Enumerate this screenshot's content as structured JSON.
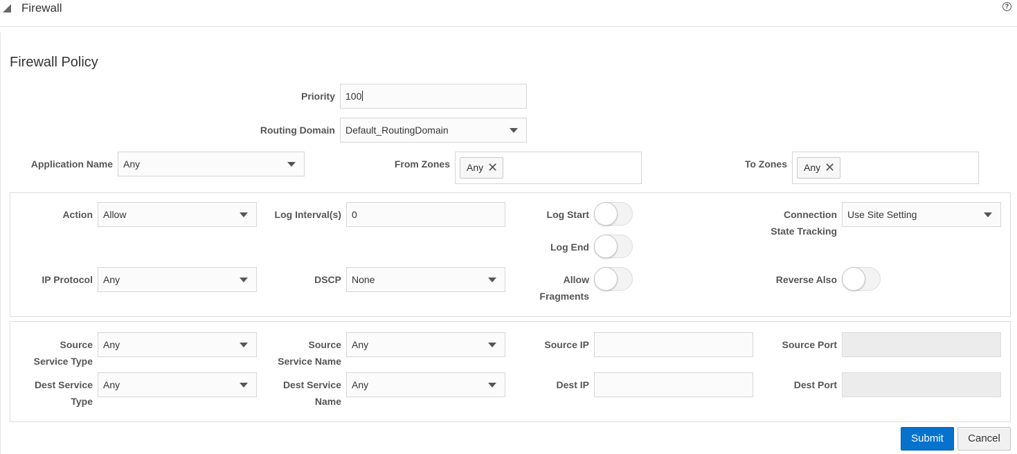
{
  "header": {
    "title": "Firewall",
    "help_glyph": "?"
  },
  "policy": {
    "title": "Firewall Policy",
    "priority": {
      "label": "Priority",
      "value": "100"
    },
    "routing_domain": {
      "label": "Routing Domain",
      "value": "Default_RoutingDomain"
    },
    "application_name": {
      "label": "Application Name",
      "value": "Any"
    },
    "from_zones": {
      "label": "From Zones",
      "tag": "Any"
    },
    "to_zones": {
      "label": "To Zones",
      "tag": "Any"
    }
  },
  "action_panel": {
    "action": {
      "label": "Action",
      "value": "Allow"
    },
    "log_interval": {
      "label": "Log Interval(s)",
      "value": "0"
    },
    "log_start": {
      "label": "Log Start",
      "on": false
    },
    "log_end": {
      "label": "Log End",
      "on": false
    },
    "connection_state": {
      "label_line1": "Connection",
      "label_line2": "State Tracking",
      "value": "Use Site Setting"
    },
    "ip_protocol": {
      "label": "IP Protocol",
      "value": "Any"
    },
    "dscp": {
      "label": "DSCP",
      "value": "None"
    },
    "allow_fragments": {
      "label_line1": "Allow",
      "label_line2": "Fragments",
      "on": false
    },
    "reverse_also": {
      "label": "Reverse Also",
      "on": false
    }
  },
  "service_panel": {
    "source_service_type": {
      "label_line1": "Source",
      "label_line2": "Service Type",
      "value": "Any"
    },
    "source_service_name": {
      "label_line1": "Source",
      "label_line2": "Service Name",
      "value": "Any"
    },
    "source_ip": {
      "label": "Source IP",
      "value": ""
    },
    "source_port": {
      "label": "Source Port",
      "value": ""
    },
    "dest_service_type": {
      "label_line1": "Dest Service",
      "label_line2": "Type",
      "value": "Any"
    },
    "dest_service_name": {
      "label_line1": "Dest Service",
      "label_line2": "Name",
      "value": "Any"
    },
    "dest_ip": {
      "label": "Dest IP",
      "value": ""
    },
    "dest_port": {
      "label": "Dest Port",
      "value": ""
    }
  },
  "buttons": {
    "submit": "Submit",
    "cancel": "Cancel"
  },
  "colors": {
    "primary": "#0572ce",
    "border": "#d6d6d6",
    "disabled_bg": "#ececec"
  },
  "icons": {
    "collapse": "triangle-collapse-icon",
    "help": "help-circle-icon",
    "remove": "close-x-icon",
    "dropdown": "caret-down-icon"
  }
}
